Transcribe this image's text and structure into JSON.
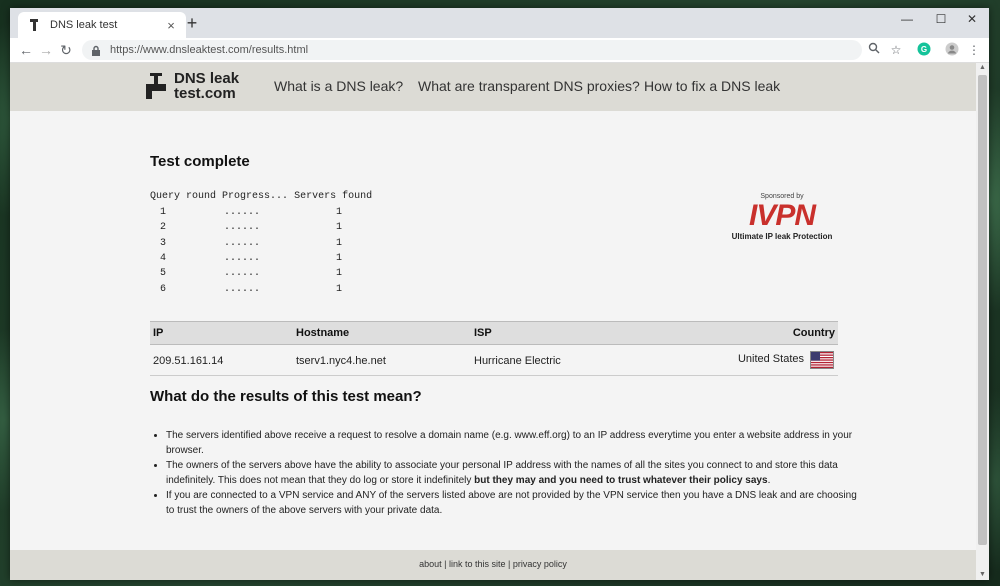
{
  "browser": {
    "tab_title": "DNS leak test",
    "tab_close": "×",
    "new_tab": "+",
    "url": "https://www.dnsleaktest.com/results.html",
    "window_controls": {
      "minimize": "—",
      "maximize": "☐",
      "close": "✕"
    },
    "nav": {
      "back": "←",
      "forward": "→",
      "reload": "↻"
    }
  },
  "site": {
    "logo_line1": "DNS leak",
    "logo_line2": "test.com",
    "nav": [
      "What is a DNS leak?",
      "What are transparent DNS proxies?",
      "How to fix a DNS leak"
    ]
  },
  "results": {
    "heading": "Test complete",
    "progress_headers": [
      "Query round",
      "Progress...",
      "Servers found"
    ],
    "rounds": [
      {
        "round": "1",
        "progress": "......",
        "servers": "1"
      },
      {
        "round": "2",
        "progress": "......",
        "servers": "1"
      },
      {
        "round": "3",
        "progress": "......",
        "servers": "1"
      },
      {
        "round": "4",
        "progress": "......",
        "servers": "1"
      },
      {
        "round": "5",
        "progress": "......",
        "servers": "1"
      },
      {
        "round": "6",
        "progress": "......",
        "servers": "1"
      }
    ],
    "sponsor": {
      "label": "Sponsored by",
      "brand": "IVPN",
      "tagline": "Ultimate IP leak Protection",
      "brand_color": "#c9302c"
    },
    "table": {
      "headers": [
        "IP",
        "Hostname",
        "ISP",
        "Country"
      ],
      "rows": [
        {
          "ip": "209.51.161.14",
          "hostname": "tserv1.nyc4.he.net",
          "isp": "Hurricane Electric",
          "country": "United States",
          "flag_icon": "us-flag-icon"
        }
      ]
    }
  },
  "explain": {
    "heading": "What do the results of this test mean?",
    "bullets": {
      "b1": "The servers identified above receive a request to resolve a domain name (e.g. www.eff.org) to an IP address everytime you enter a website address in your browser.",
      "b2_pre": "The owners of the servers above have the ability to associate your personal IP address with the names of all the sites you connect to and store this data indefinitely. This does not mean that they do log or store it indefinitely ",
      "b2_bold": "but they may and you need to trust whatever their policy says",
      "b2_post": ".",
      "b3": "If you are connected to a VPN service and ANY of the servers listed above are not provided by the VPN service then you have a DNS leak and are choosing to trust the owners of the above servers with your private data."
    }
  },
  "footer": {
    "about": "about",
    "sep1": " | ",
    "link": "link to this site",
    "sep2": " | ",
    "privacy": "privacy policy"
  }
}
